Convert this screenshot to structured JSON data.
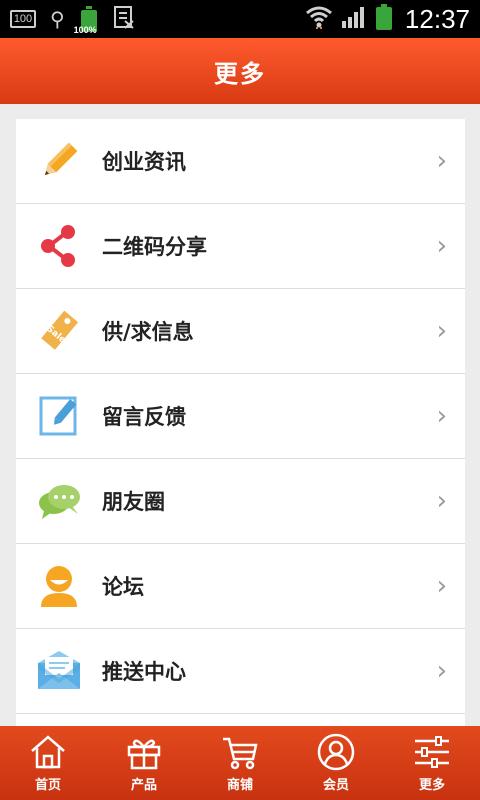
{
  "status_bar": {
    "left_box_text": "100",
    "battery_small_pct": "100%",
    "time": "12:37",
    "colors": {
      "background": "#000000",
      "battery": "#3aa53a"
    }
  },
  "header": {
    "title": "更多",
    "color": "#e04a20"
  },
  "menu": {
    "items": [
      {
        "label": "创业资讯",
        "icon": "pencil-icon"
      },
      {
        "label": "二维码分享",
        "icon": "share-icon"
      },
      {
        "label": "供/求信息",
        "icon": "sale-tag-icon"
      },
      {
        "label": "留言反馈",
        "icon": "edit-note-icon"
      },
      {
        "label": "朋友圈",
        "icon": "chat-bubbles-icon"
      },
      {
        "label": "论坛",
        "icon": "user-avatar-icon"
      },
      {
        "label": "推送中心",
        "icon": "envelope-icon"
      }
    ],
    "chevron": "›"
  },
  "bottom_nav": {
    "items": [
      {
        "label": "首页",
        "icon": "home-icon"
      },
      {
        "label": "产品",
        "icon": "gift-icon"
      },
      {
        "label": "商铺",
        "icon": "cart-icon"
      },
      {
        "label": "会员",
        "icon": "member-icon"
      },
      {
        "label": "更多",
        "icon": "sliders-icon"
      }
    ]
  }
}
